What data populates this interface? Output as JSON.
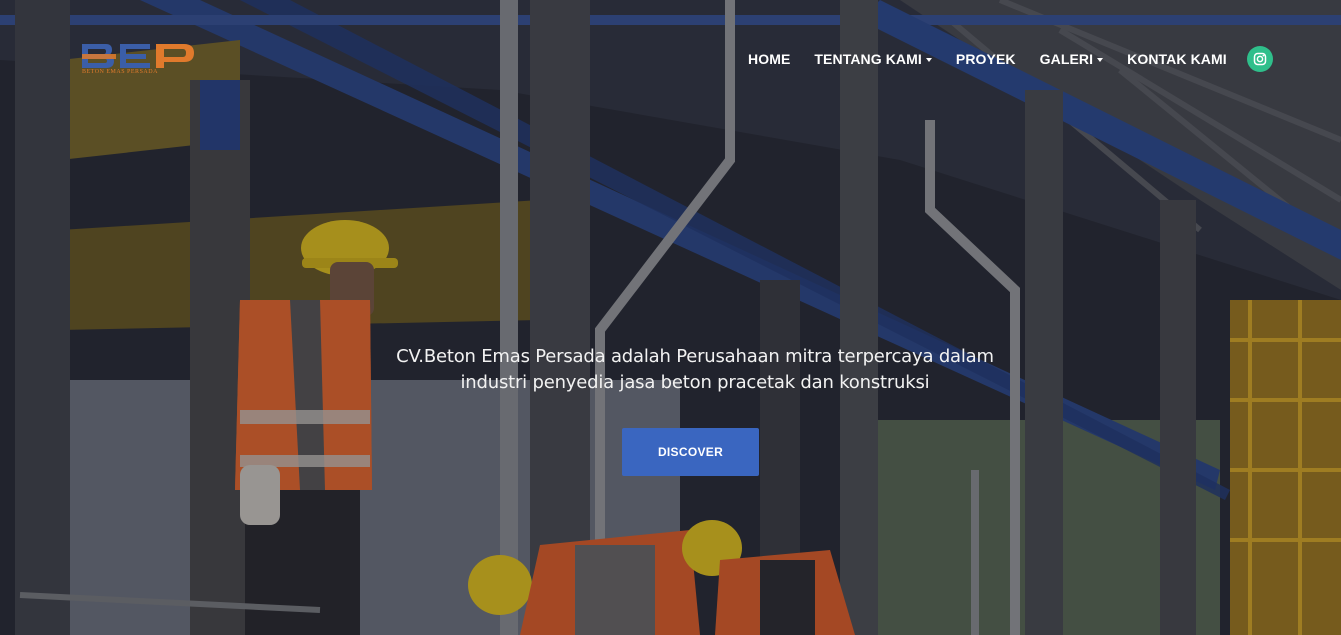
{
  "brand": {
    "logo_mark": "BEP",
    "logo_subtitle": "BETON EMAS PERSADA",
    "logo_colors": {
      "letters": "#3b5ea8",
      "accent": "#e07a2c"
    }
  },
  "nav": {
    "items": [
      {
        "label": "HOME",
        "dropdown": false
      },
      {
        "label": "TENTANG KAMI",
        "dropdown": true
      },
      {
        "label": "PROYEK",
        "dropdown": false
      },
      {
        "label": "GALERI",
        "dropdown": true
      },
      {
        "label": "KONTAK KAMI",
        "dropdown": false
      }
    ],
    "social_icon": "instagram-icon",
    "social_color": "#2fbf8b"
  },
  "hero": {
    "tagline_line1": "CV.Beton Emas Persada adalah Perusahaan mitra terpercaya dalam",
    "tagline_line2": "industri penyedia jasa beton pracetak dan konstruksi",
    "cta_label": "DISCOVER",
    "cta_color": "#3a66c0",
    "background_image": "construction-workers-in-hard-hats-and-safety-vests-photo"
  }
}
